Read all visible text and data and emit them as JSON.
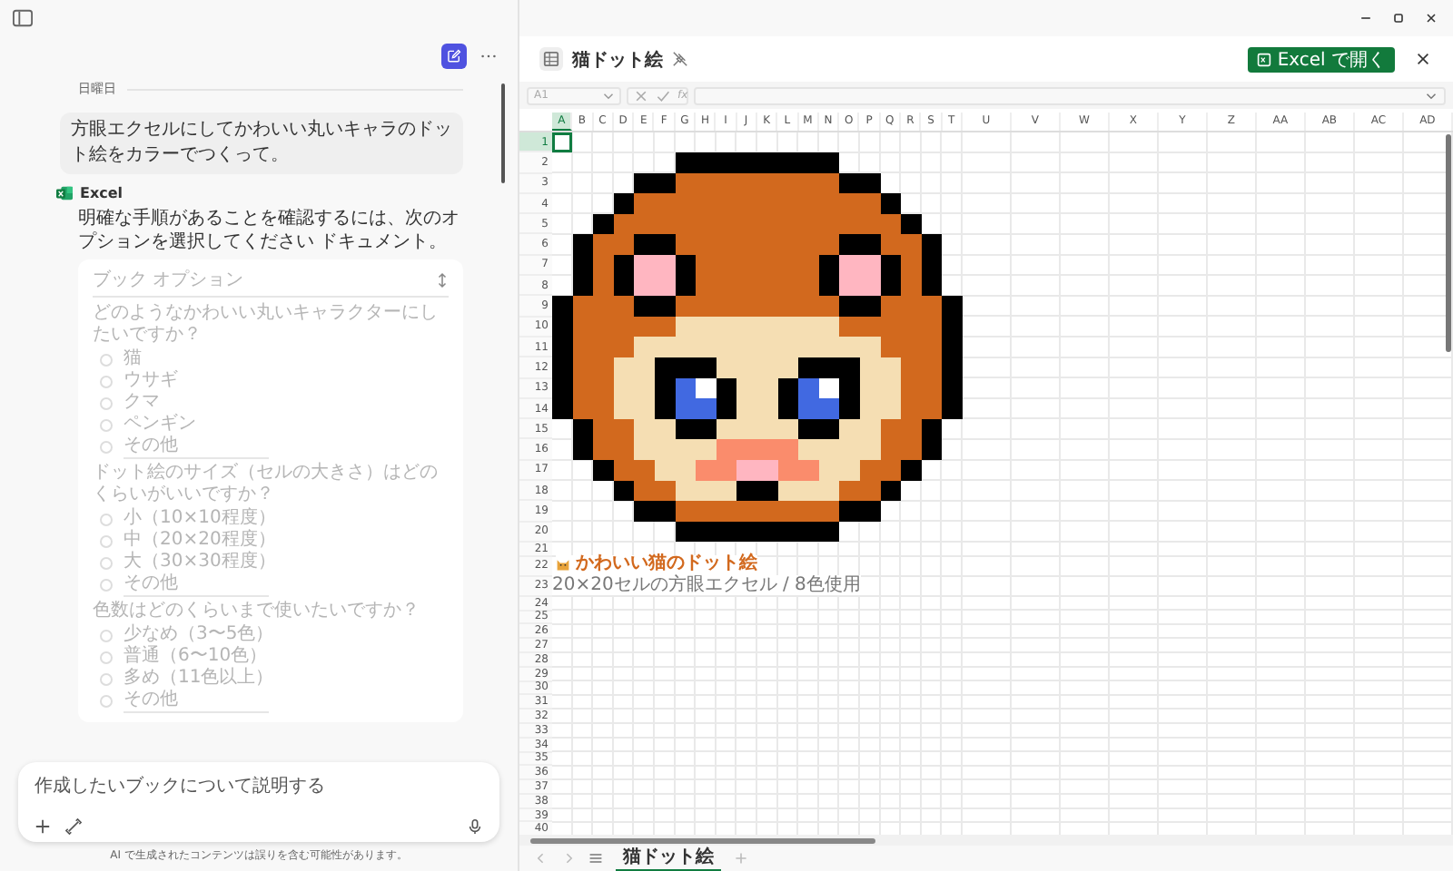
{
  "chat": {
    "date": "日曜日",
    "user_message": "方眼エクセルにしてかわいい丸いキャラのドット絵をカラーでつくって。",
    "assistant": {
      "name": "Excel",
      "message": "明確な手順があることを確認するには、次のオプションを選択してください ドキュメント。"
    },
    "options_card": {
      "title": "ブック オプション",
      "disabled": true,
      "questions": [
        {
          "text": "どのようなかわいい丸いキャラクターにしたいですか？",
          "options": [
            {
              "label": "猫",
              "kind": "choice",
              "selected": false
            },
            {
              "label": "ウサギ",
              "kind": "choice",
              "selected": false
            },
            {
              "label": "クマ",
              "kind": "choice",
              "selected": false
            },
            {
              "label": "ペンギン",
              "kind": "choice",
              "selected": false
            },
            {
              "label": "その他",
              "kind": "other",
              "selected": false
            }
          ]
        },
        {
          "text": "ドット絵のサイズ（セルの大きさ）はどのくらいがいいですか？",
          "options": [
            {
              "label": "小（10×10程度）",
              "kind": "choice",
              "selected": false
            },
            {
              "label": "中（20×20程度）",
              "kind": "choice",
              "selected": false
            },
            {
              "label": "大（30×30程度）",
              "kind": "choice",
              "selected": false
            },
            {
              "label": "その他",
              "kind": "other",
              "selected": false
            }
          ]
        },
        {
          "text": "色数はどのくらいまで使いたいですか？",
          "options": [
            {
              "label": "少なめ（3〜5色）",
              "kind": "choice",
              "selected": false
            },
            {
              "label": "普通（6〜10色）",
              "kind": "choice",
              "selected": false
            },
            {
              "label": "多め（11色以上）",
              "kind": "choice",
              "selected": false
            },
            {
              "label": "その他",
              "kind": "other",
              "selected": false
            }
          ]
        }
      ]
    }
  },
  "composer": {
    "placeholder": "作成したいブックについて説明する"
  },
  "disclaimer": "AI で生成されたコンテンツは誤りを含む可能性があります。",
  "document": {
    "title": "猫ドット絵",
    "open_button": "Excel で開く"
  },
  "formula_bar": {
    "name_box": "A1",
    "function_label": "fx"
  },
  "sheet": {
    "columns": [
      {
        "label": "A",
        "selected": true
      },
      {
        "label": "B",
        "selected": false
      },
      {
        "label": "C",
        "selected": false
      },
      {
        "label": "D",
        "selected": false
      },
      {
        "label": "E",
        "selected": false
      },
      {
        "label": "F",
        "selected": false
      },
      {
        "label": "G",
        "selected": false
      },
      {
        "label": "H",
        "selected": false
      },
      {
        "label": "I",
        "selected": false
      },
      {
        "label": "J",
        "selected": false
      },
      {
        "label": "K",
        "selected": false
      },
      {
        "label": "L",
        "selected": false
      },
      {
        "label": "M",
        "selected": false
      },
      {
        "label": "N",
        "selected": false
      },
      {
        "label": "O",
        "selected": false
      },
      {
        "label": "P",
        "selected": false
      },
      {
        "label": "Q",
        "selected": false
      },
      {
        "label": "R",
        "selected": false
      },
      {
        "label": "S",
        "selected": false
      },
      {
        "label": "T",
        "selected": false
      },
      {
        "label": "U",
        "selected": false
      },
      {
        "label": "V",
        "selected": false
      },
      {
        "label": "W",
        "selected": false
      },
      {
        "label": "X",
        "selected": false
      },
      {
        "label": "Y",
        "selected": false
      },
      {
        "label": "Z",
        "selected": false
      },
      {
        "label": "AA",
        "selected": false
      },
      {
        "label": "AB",
        "selected": false
      },
      {
        "label": "AC",
        "selected": false
      },
      {
        "label": "AD",
        "selected": false
      }
    ],
    "rows": [
      {
        "label": "1",
        "selected": true
      },
      {
        "label": "2",
        "selected": false
      },
      {
        "label": "3",
        "selected": false
      },
      {
        "label": "4",
        "selected": false
      },
      {
        "label": "5",
        "selected": false
      },
      {
        "label": "6",
        "selected": false
      },
      {
        "label": "7",
        "selected": false
      },
      {
        "label": "8",
        "selected": false
      },
      {
        "label": "9",
        "selected": false
      },
      {
        "label": "10",
        "selected": false
      },
      {
        "label": "11",
        "selected": false
      },
      {
        "label": "12",
        "selected": false
      },
      {
        "label": "13",
        "selected": false
      },
      {
        "label": "14",
        "selected": false
      },
      {
        "label": "15",
        "selected": false
      },
      {
        "label": "16",
        "selected": false
      },
      {
        "label": "17",
        "selected": false
      },
      {
        "label": "18",
        "selected": false
      },
      {
        "label": "19",
        "selected": false
      },
      {
        "label": "20",
        "selected": false
      },
      {
        "label": "21",
        "selected": false
      },
      {
        "label": "22",
        "selected": false
      },
      {
        "label": "23",
        "selected": false
      },
      {
        "label": "24",
        "selected": false
      },
      {
        "label": "25",
        "selected": false
      },
      {
        "label": "26",
        "selected": false
      },
      {
        "label": "27",
        "selected": false
      },
      {
        "label": "28",
        "selected": false
      },
      {
        "label": "29",
        "selected": false
      },
      {
        "label": "30",
        "selected": false
      },
      {
        "label": "31",
        "selected": false
      },
      {
        "label": "32",
        "selected": false
      },
      {
        "label": "33",
        "selected": false
      },
      {
        "label": "34",
        "selected": false
      },
      {
        "label": "35",
        "selected": false
      },
      {
        "label": "36",
        "selected": false
      },
      {
        "label": "37",
        "selected": false
      },
      {
        "label": "38",
        "selected": false
      },
      {
        "label": "39",
        "selected": false
      },
      {
        "label": "40",
        "selected": false
      }
    ],
    "title_cell": "かわいい猫のドット絵",
    "caption_cell": "20×20セルの方眼エクセル / 8色使用"
  },
  "sheet_tabs": [
    {
      "label": "猫ドット絵",
      "selected": true
    }
  ]
}
